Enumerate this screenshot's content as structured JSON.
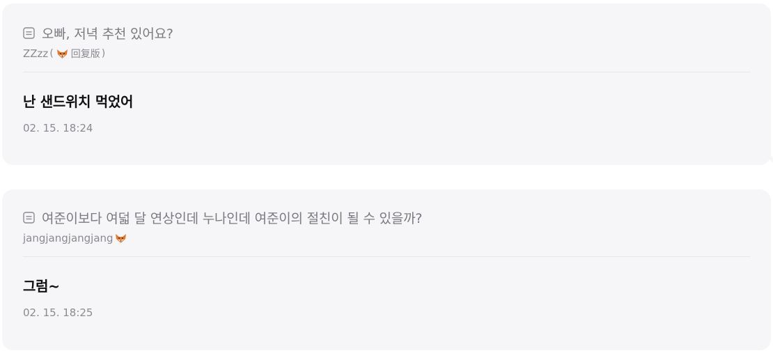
{
  "items": [
    {
      "question": "오빠, 저녁 추천 있어요?",
      "author": "ZZzz",
      "author_badge": "回复版",
      "answer": "난 샌드위치 먹었어",
      "timestamp": "02. 15. 18:24"
    },
    {
      "question": "여준이보다 여덟 달 연상인데 누나인데 여준이의 절친이 될 수 있을까?",
      "author": "jangjangjangjang",
      "answer": "그럼~",
      "timestamp": "02. 15. 18:25"
    }
  ],
  "icons": {
    "question": "note-icon",
    "author_emoji": "fox-icon"
  },
  "colors": {
    "card_background": "#f6f6f8",
    "muted_text": "#7a7a80",
    "answer_text": "#111111",
    "divider": "#e7e7ea"
  }
}
